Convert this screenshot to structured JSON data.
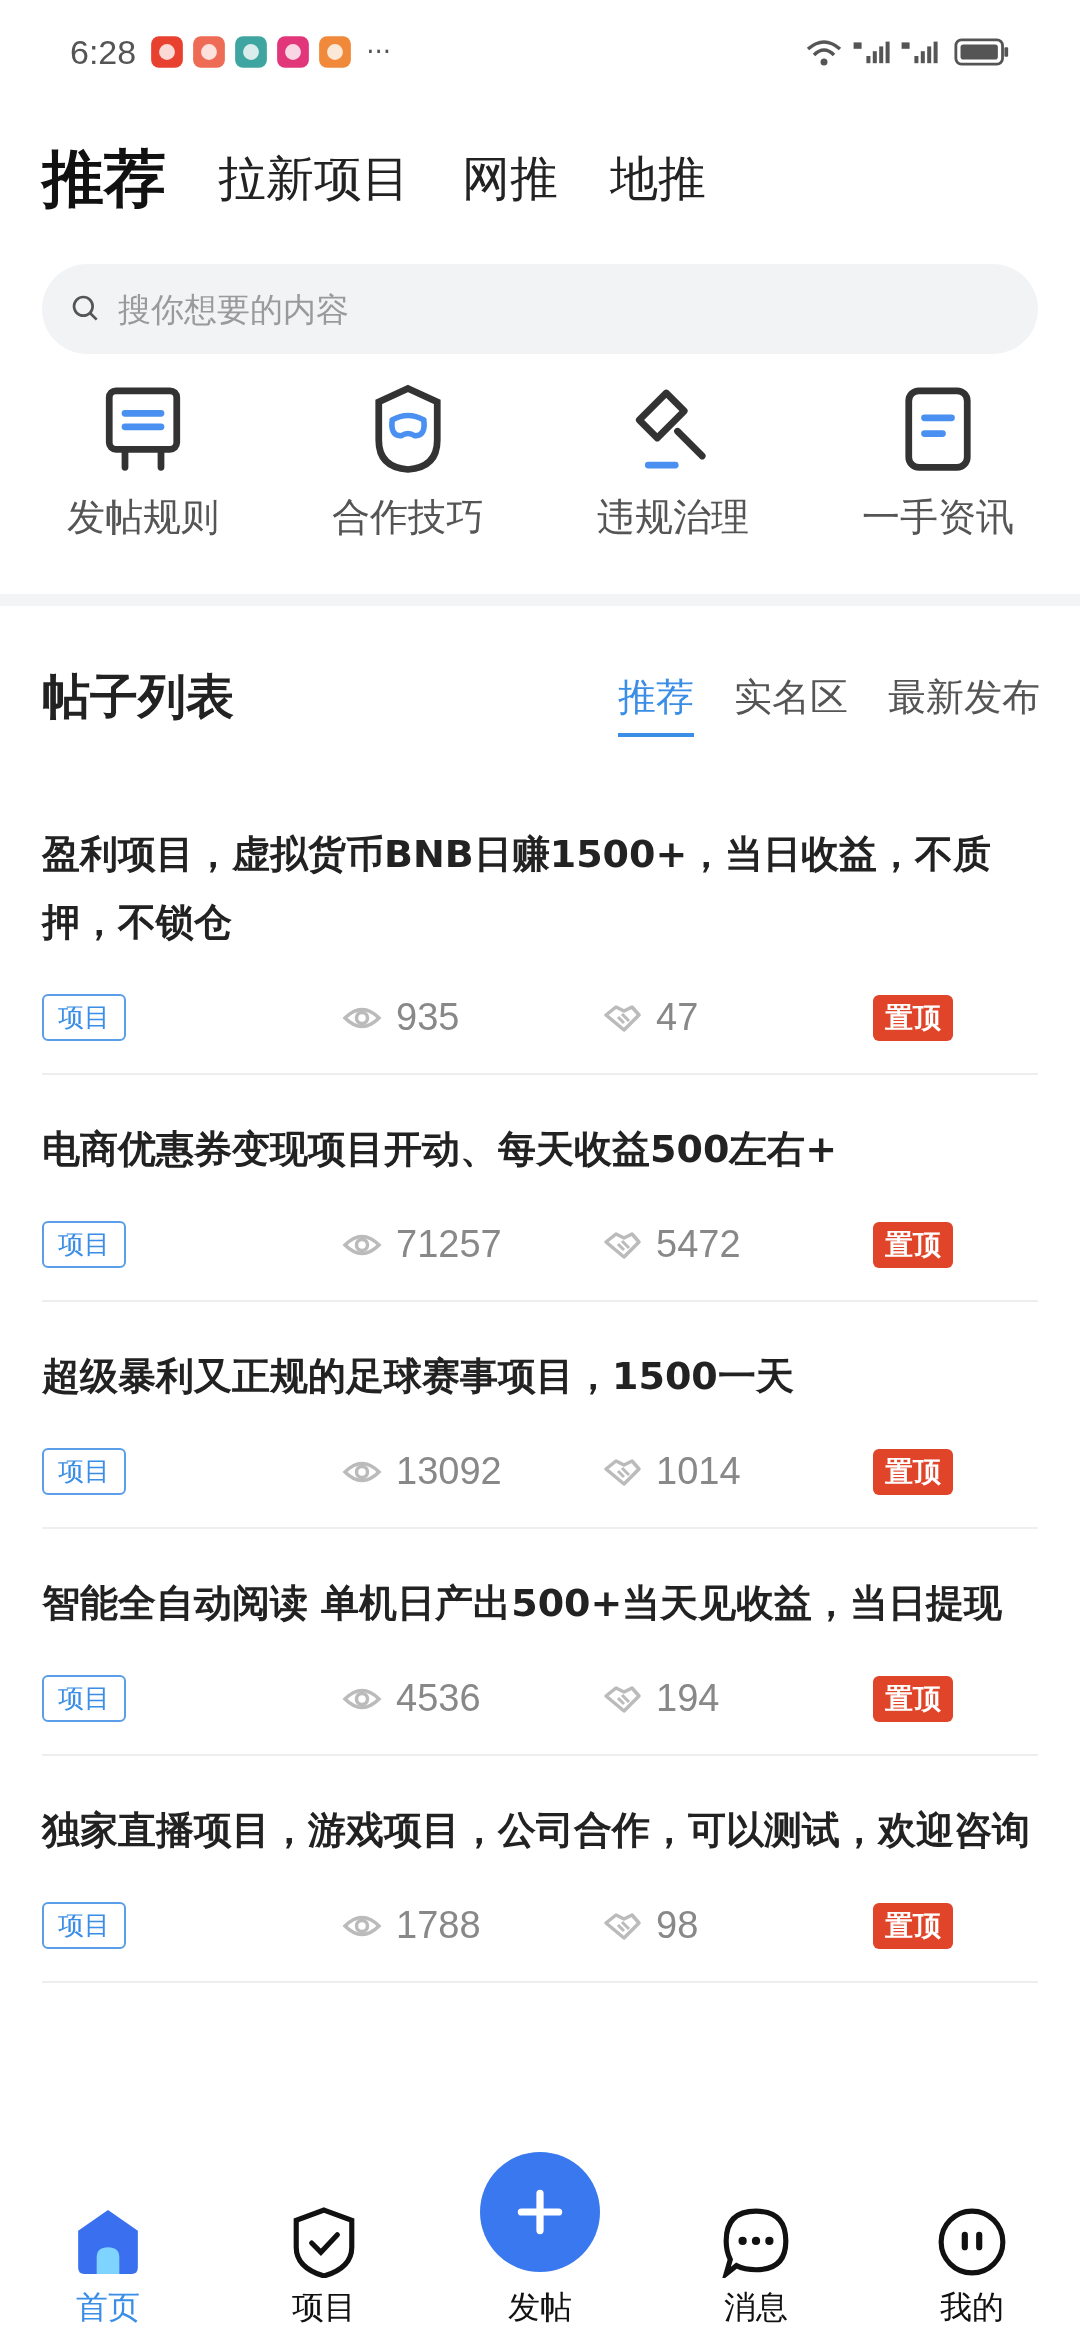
{
  "status_bar": {
    "time": "6:28",
    "more": "···"
  },
  "top_tabs": [
    {
      "label": "推荐",
      "selected": true
    },
    {
      "label": "拉新项目",
      "selected": false
    },
    {
      "label": "网推",
      "selected": false
    },
    {
      "label": "地推",
      "selected": false
    }
  ],
  "search": {
    "placeholder": "搜你想要的内容"
  },
  "shortcuts": [
    {
      "label": "发帖规则",
      "kind": "board"
    },
    {
      "label": "合作技巧",
      "kind": "shield"
    },
    {
      "label": "违规治理",
      "kind": "gavel"
    },
    {
      "label": "一手资讯",
      "kind": "doc"
    }
  ],
  "post_list": {
    "title": "帖子列表",
    "tabs": [
      {
        "label": "推荐",
        "selected": true
      },
      {
        "label": "实名区",
        "selected": false
      },
      {
        "label": "最新发布",
        "selected": false
      }
    ]
  },
  "posts": [
    {
      "title": "盈利项目，虚拟货币BNB日赚1500+，当日收益，不质押，不锁仓",
      "tag": "项目",
      "views": "935",
      "likes": "47",
      "badge": "置顶"
    },
    {
      "title": "电商优惠券变现项目开动、每天收益500左右+",
      "tag": "项目",
      "views": "71257",
      "likes": "5472",
      "badge": "置顶"
    },
    {
      "title": "超级暴利又正规的足球赛事项目，1500一天",
      "tag": "项目",
      "views": "13092",
      "likes": "1014",
      "badge": "置顶"
    },
    {
      "title": "智能全自动阅读 单机日产出500+当天见收益，当日提现",
      "tag": "项目",
      "views": "4536",
      "likes": "194",
      "badge": "置顶"
    },
    {
      "title": "独家直播项目，游戏项目，公司合作，可以测试，欢迎咨询",
      "tag": "项目",
      "views": "1788",
      "likes": "98",
      "badge": "置顶"
    }
  ],
  "bottom_nav": [
    {
      "label": "首页",
      "kind": "home",
      "selected": true
    },
    {
      "label": "项目",
      "kind": "shield",
      "selected": false
    },
    {
      "label": "发帖",
      "kind": "fab",
      "selected": false
    },
    {
      "label": "消息",
      "kind": "chat",
      "selected": false
    },
    {
      "label": "我的",
      "kind": "face",
      "selected": false
    }
  ]
}
